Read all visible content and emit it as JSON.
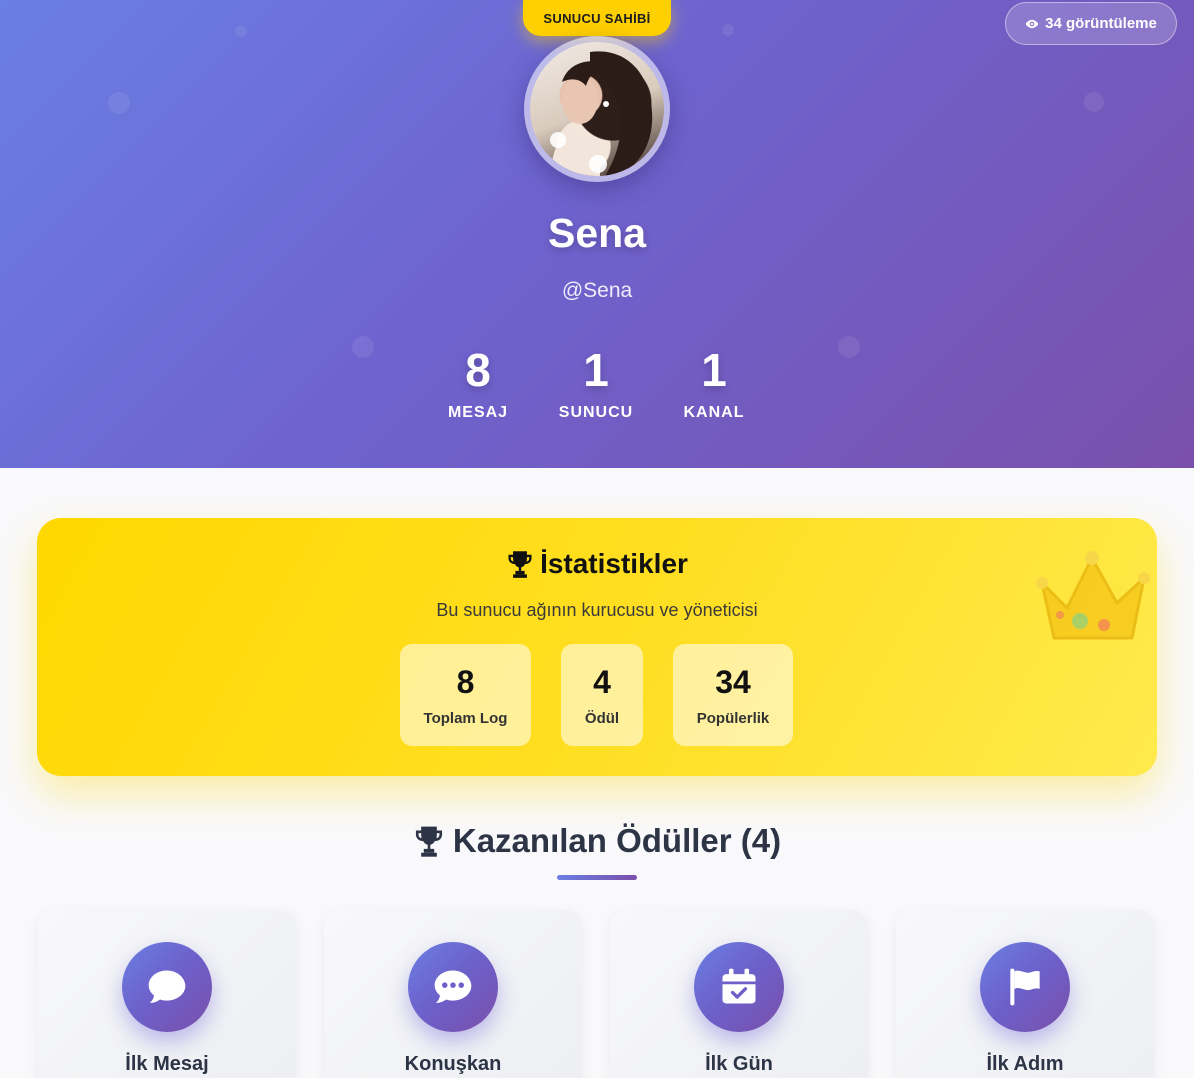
{
  "header": {
    "role_badge": "SUNUCU SAHİBİ",
    "views": "34 görüntüleme",
    "name": "Sena",
    "handle": "@Sena",
    "stats": [
      {
        "value": "8",
        "label": "MESAJ"
      },
      {
        "value": "1",
        "label": "SUNUCU"
      },
      {
        "value": "1",
        "label": "KANAL"
      }
    ]
  },
  "stats_card": {
    "title": "İstatistikler",
    "subtitle": "Bu sunucu ağının kurucusu ve yöneticisi",
    "items": [
      {
        "value": "8",
        "label": "Toplam Log"
      },
      {
        "value": "4",
        "label": "Ödül"
      },
      {
        "value": "34",
        "label": "Popülerlik"
      }
    ]
  },
  "awards": {
    "title": "Kazanılan Ödüller (4)",
    "items": [
      {
        "name": "İlk Mesaj",
        "icon": "comment-icon"
      },
      {
        "name": "Konuşkan",
        "icon": "comment-dots-icon"
      },
      {
        "name": "İlk Gün",
        "icon": "calendar-check-icon"
      },
      {
        "name": "İlk Adım",
        "icon": "flag-icon"
      }
    ]
  },
  "colors": {
    "hero_gradient_start": "#6a7fe3",
    "hero_gradient_end": "#7a50ab",
    "badge_yellow": "#ffd000",
    "stats_card_yellow": "#ffd800",
    "heading_dark": "#2c3446"
  }
}
